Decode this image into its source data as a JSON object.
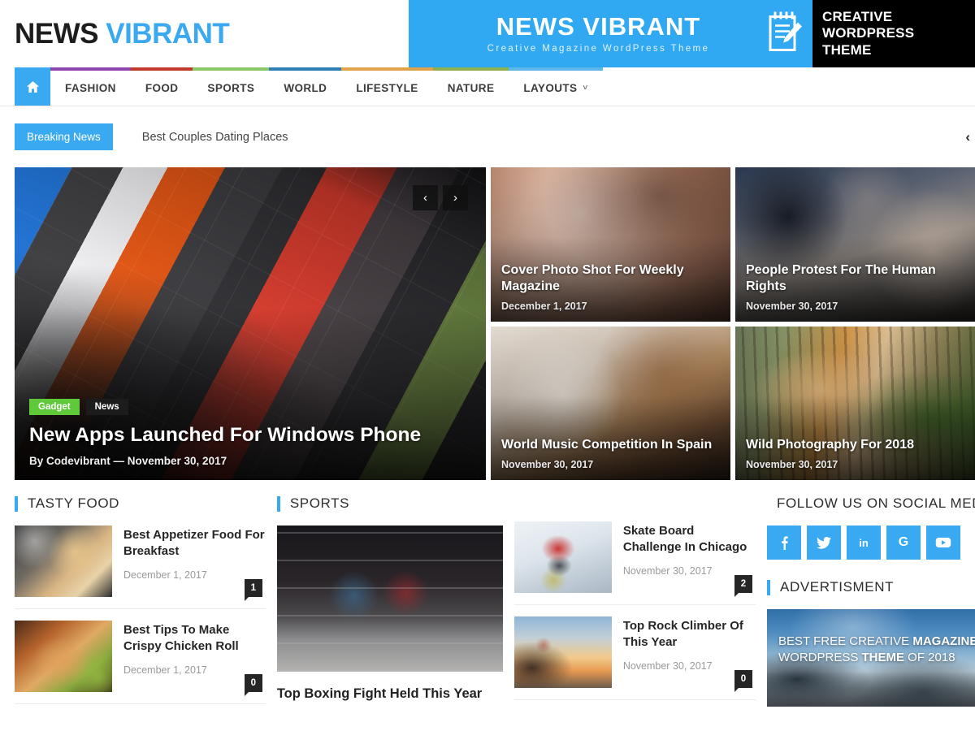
{
  "site": {
    "logo_news": "NEWS",
    "logo_vibrant": "VIBRANT"
  },
  "header_banner": {
    "title": "NEWS VIBRANT",
    "subtitle": "Creative Magazine WordPress Theme",
    "icon": "notepad-pencil-icon",
    "badge_line1": "CREATIVE",
    "badge_line2": "WORDPRESS",
    "badge_line3": "THEME"
  },
  "nav": {
    "home_icon": "home-icon",
    "items": [
      {
        "label": "FASHION",
        "color": "#8e44ad",
        "has_caret": false
      },
      {
        "label": "FOOD",
        "color": "#c0392b",
        "has_caret": false
      },
      {
        "label": "SPORTS",
        "color": "#8cc765",
        "has_caret": false
      },
      {
        "label": "WORLD",
        "color": "#2e7eb3",
        "has_caret": false
      },
      {
        "label": "LIFESTYLE",
        "color": "#e0a busy",
        "has_caret": false
      },
      {
        "label": "NATURE",
        "color": "#8fae4e",
        "has_caret": false
      },
      {
        "label": "LAYOUTS",
        "color": "#5bb8e8",
        "has_caret": true,
        "caret": "˅"
      }
    ]
  },
  "breaking": {
    "tag": "Breaking News",
    "headline": "Best Couples Dating Places",
    "prev_icon": "chevron-left-icon",
    "prev_glyph": "‹"
  },
  "hero": {
    "tags": [
      "Gadget",
      "News"
    ],
    "title": "New Apps Launched For Windows Phone",
    "author_prefix": "By",
    "author": "Codevibrant",
    "separator": "—",
    "date": "November 30, 2017",
    "meta": "By Codevibrant  —  November 30, 2017",
    "prev_glyph": "‹",
    "next_glyph": "›",
    "prev_icon": "slider-prev-icon",
    "next_icon": "slider-next-icon"
  },
  "featured_cards": [
    {
      "title": "Cover Photo Shot For Weekly Magazine",
      "date": "December 1, 2017"
    },
    {
      "title": "People Protest For The Human Rights",
      "date": "November 30, 2017"
    },
    {
      "title": "World Music Competition In Spain",
      "date": "November 30, 2017"
    },
    {
      "title": "Wild Photography For 2018",
      "date": "November 30, 2017"
    }
  ],
  "tasty_food": {
    "section_title": "TASTY FOOD",
    "posts": [
      {
        "title": "Best Appetizer Food For Breakfast",
        "date": "December 1, 2017",
        "comments": "1"
      },
      {
        "title": "Best Tips To Make Crispy Chicken Roll",
        "date": "December 1, 2017",
        "comments": "0"
      }
    ]
  },
  "sports": {
    "section_title": "SPORTS",
    "main_post": {
      "title": "Top Boxing Fight Held This Year"
    },
    "posts": [
      {
        "title": "Skate Board Challenge In Chicago",
        "date": "November 30, 2017",
        "comments": "2"
      },
      {
        "title": "Top Rock Climber Of This Year",
        "date": "November 30, 2017",
        "comments": "0"
      }
    ]
  },
  "sidebar": {
    "social_title": "FOLLOW US ON SOCIAL MEDIA",
    "social": [
      {
        "name": "facebook-icon",
        "glyph": "f"
      },
      {
        "name": "twitter-icon",
        "glyph": "ᵗ"
      },
      {
        "name": "linkedin-icon",
        "glyph": "in"
      },
      {
        "name": "google-plus-icon",
        "glyph": "G"
      },
      {
        "name": "youtube-icon",
        "glyph": "▶"
      }
    ],
    "ad_title": "ADVERTISMENT",
    "ad_line1_plain": "BEST FREE CREATIVE ",
    "ad_line1_bold": "MAGAZINE",
    "ad_line2_plain": "WORDPRESS ",
    "ad_line2_bold": "THEME",
    "ad_line2_tail": " OF 2018"
  },
  "colors": {
    "accent": "#39a9f1",
    "dark": "#1c1c1c",
    "tag_green": "#5fc93a"
  }
}
